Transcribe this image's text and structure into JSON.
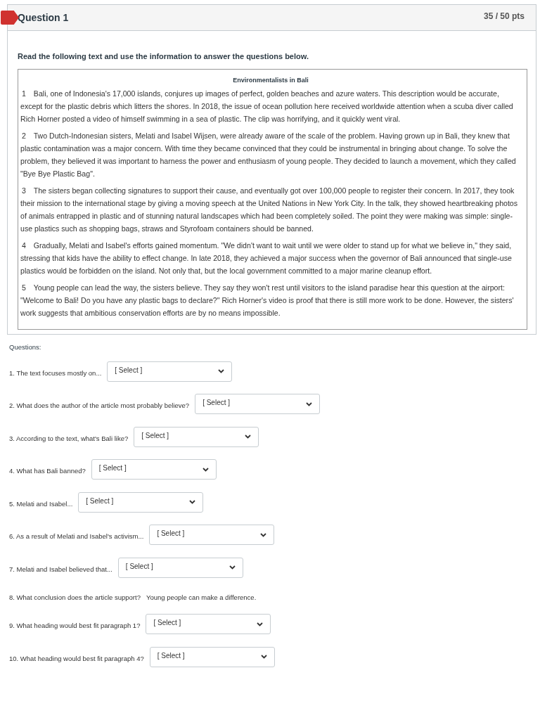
{
  "question": {
    "title": "Question 1",
    "points": "35 / 50 pts",
    "flagged": true
  },
  "instruction": "Read the following text and use the information to answer the questions below.",
  "passage": {
    "title": "Environmentalists in Bali",
    "paragraphs": [
      {
        "number": "1",
        "text": "Bali, one of Indonesia's 17,000 islands, conjures up images of perfect, golden beaches and azure waters. This description would be accurate, except for the plastic debris which litters the shores. In 2018, the issue of ocean pollution here received worldwide attention when a scuba diver called Rich Horner posted a video of himself swimming in a sea of plastic. The clip was horrifying, and it quickly went viral."
      },
      {
        "number": "2",
        "text": "Two Dutch-Indonesian sisters, Melati and Isabel Wijsen, were already aware of the scale of the problem. Having grown up in Bali, they knew that plastic contamination was a major concern. With time they became convinced that they could be instrumental in bringing about change. To solve the problem, they believed it was important to harness the power and enthusiasm of young people. They decided to launch a movement, which they called \"Bye Bye Plastic Bag\"."
      },
      {
        "number": "3",
        "text": "The sisters began collecting signatures to support their cause, and eventually got over 100,000 people to register their concern. In 2017, they took their mission to the international stage by giving a moving speech at the United Nations in New York City. In the talk, they showed heartbreaking photos of animals entrapped in plastic and of stunning natural landscapes which had been completely soiled. The point they were making was simple: single-use plastics such as shopping bags, straws and Styrofoam containers should be banned."
      },
      {
        "number": "4",
        "text": "Gradually, Melati and Isabel's efforts gained momentum. \"We didn't want to wait until we were older to stand up for what we believe in,\" they said, stressing that kids have the ability to effect change. In late 2018, they achieved a major success when the governor of Bali announced that single-use plastics would be forbidden on the island. Not only that, but the local government committed to a major marine cleanup effort."
      },
      {
        "number": "5",
        "text": "Young people can lead the way, the sisters believe. They say they won't rest until visitors to the island paradise hear this question at the airport: \"Welcome to Bali! Do you have any plastic bags to declare?\" Rich Horner's video is proof that there is still more work to be done. However, the sisters' work suggests that ambitious conservation efforts are by no means impossible."
      }
    ]
  },
  "questions_label": "Questions:",
  "questions": [
    {
      "kind": "select",
      "prompt": "1. The text focuses mostly on...",
      "value": "[ Select ]"
    },
    {
      "kind": "select",
      "prompt": "2. What does the author of the article most probably believe?",
      "value": "[ Select ]"
    },
    {
      "kind": "select",
      "prompt": "3. According to the text, what's Bali like?",
      "value": "[ Select ]"
    },
    {
      "kind": "select",
      "prompt": "4. What has Bali banned?",
      "value": "[ Select ]"
    },
    {
      "kind": "select",
      "prompt": "5. Melati and Isabel...",
      "value": "[ Select ]"
    },
    {
      "kind": "select",
      "prompt": "6. As a result of Melati and Isabel's activism...",
      "value": "[ Select ]"
    },
    {
      "kind": "select",
      "prompt": "7. Melati and Isabel believed that...",
      "value": "[ Select ]"
    },
    {
      "kind": "answer",
      "prompt": "8. What conclusion does the article support?",
      "value": "Young people can make a difference."
    },
    {
      "kind": "select",
      "prompt": "9. What heading would best fit paragraph 1?",
      "value": "[ Select ]"
    },
    {
      "kind": "select",
      "prompt": "10. What heading would best fit paragraph 4?",
      "value": "[ Select ]"
    }
  ]
}
